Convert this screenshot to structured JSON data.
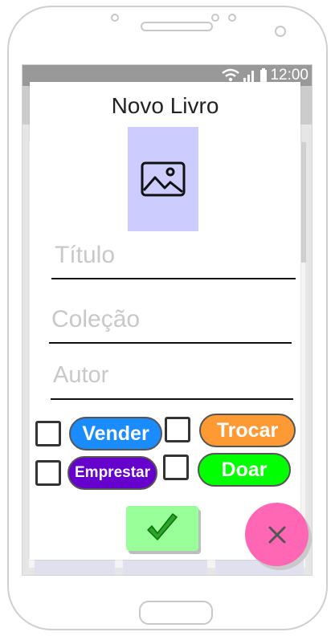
{
  "status_bar": {
    "time": "12:00",
    "icons": [
      "wifi-icon",
      "signal-icon",
      "battery-icon"
    ]
  },
  "dialog": {
    "title": "Novo Livro",
    "image_icon": "image-icon",
    "fields": {
      "title_placeholder": "Título",
      "collection_placeholder": "Coleção",
      "author_placeholder": "Autor"
    },
    "options": [
      {
        "label": "Vender",
        "color": "#1a8cff",
        "checked": false
      },
      {
        "label": "Trocar",
        "color": "#ff9933",
        "checked": false
      },
      {
        "label": "Emprestar",
        "color": "#6600cc",
        "checked": false
      },
      {
        "label": "Doar",
        "color": "#00ff00",
        "checked": false
      }
    ],
    "confirm_icon": "checkmark-icon",
    "close_icon": "close-icon"
  },
  "colors": {
    "image_placeholder_bg": "#ccccff",
    "confirm_bg": "#99ff99",
    "fab_bg": "#ff66b3"
  }
}
